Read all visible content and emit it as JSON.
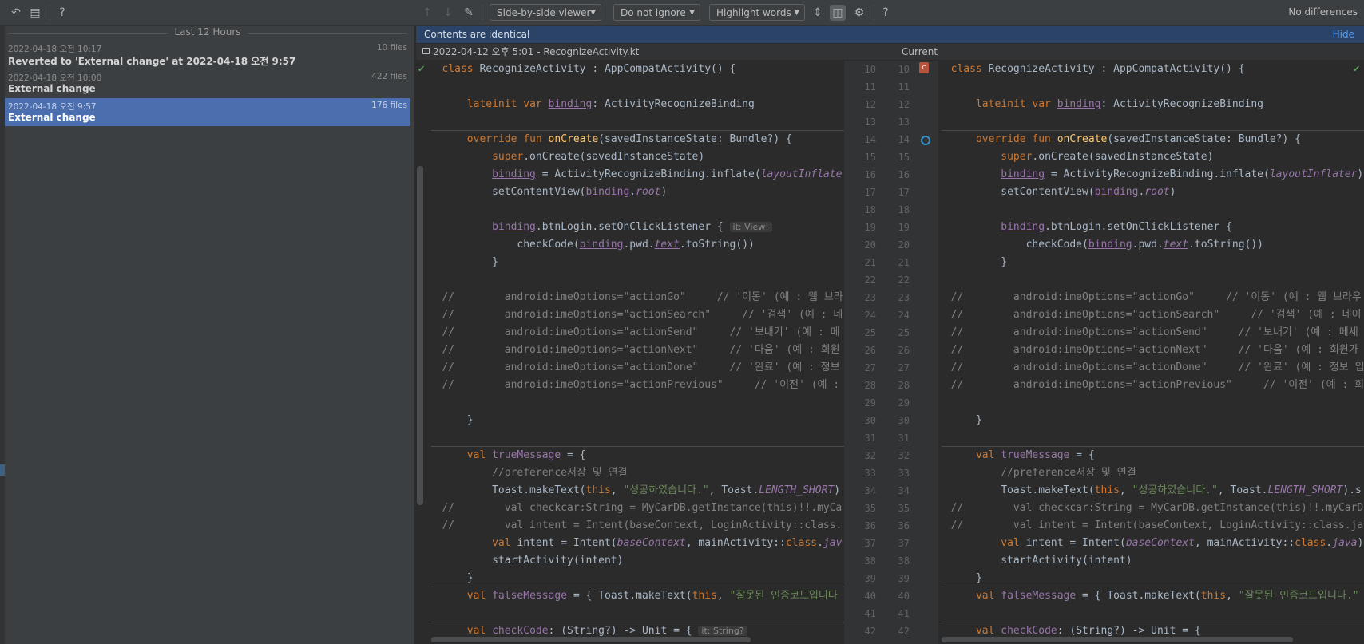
{
  "toolbar": {
    "viewer_mode": "Side-by-side viewer",
    "whitespace_mode": "Do not ignore",
    "highlight_mode": "Highlight words",
    "status": "No differences"
  },
  "history": {
    "group_label": "Last 12 Hours",
    "revisions": [
      {
        "date": "2022-04-18 오전 10:17",
        "files": "10 files",
        "title": "Reverted to 'External change' at 2022-04-18 오전 9:57"
      },
      {
        "date": "2022-04-18 오전 10:00",
        "files": "422 files",
        "title": "External change"
      },
      {
        "date": "2022-04-18 오전 9:57",
        "files": "176 files",
        "title": "External change"
      }
    ]
  },
  "banner": {
    "message": "Contents are identical",
    "hide_label": "Hide"
  },
  "left_file": {
    "label": "2022-04-12 오후 5:01 - RecognizeActivity.kt"
  },
  "right_file": {
    "label": "Current"
  },
  "line_numbers": [
    "10",
    "11",
    "12",
    "13",
    "14",
    "15",
    "16",
    "17",
    "18",
    "19",
    "20",
    "21",
    "22",
    "23",
    "24",
    "25",
    "26",
    "27",
    "28",
    "29",
    "30",
    "31",
    "32",
    "33",
    "34",
    "35",
    "36",
    "37",
    "38",
    "39",
    "40",
    "41",
    "42"
  ],
  "hints": {
    "it_view": "it: View!",
    "it_string": "it: String?"
  }
}
